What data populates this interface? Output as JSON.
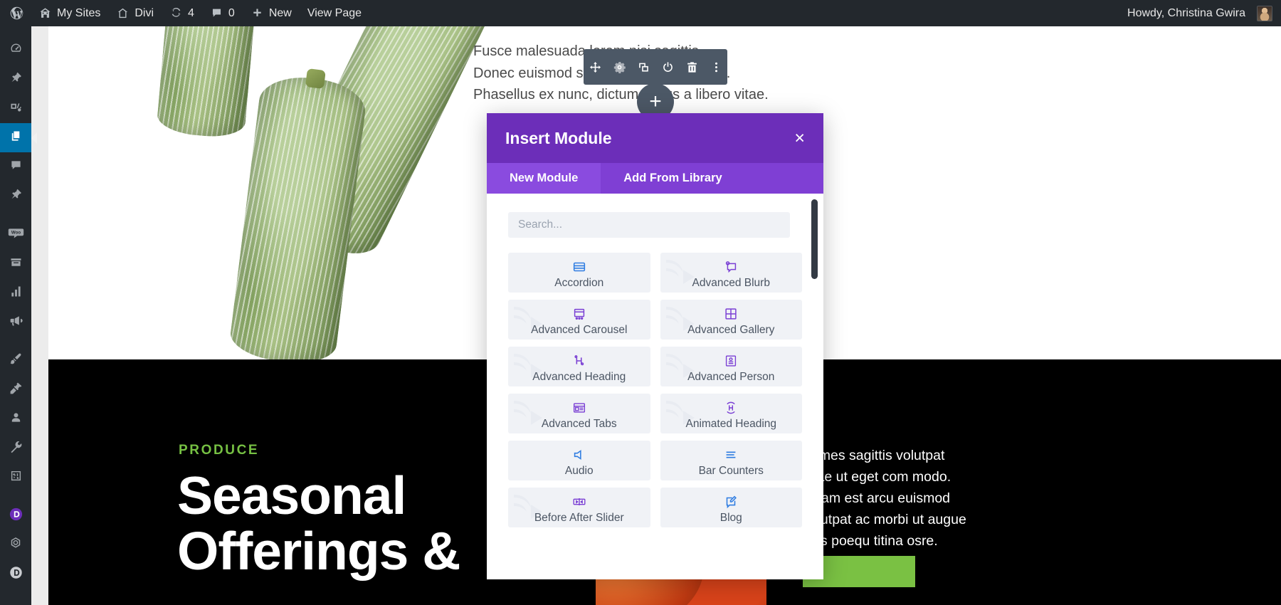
{
  "adminbar": {
    "left_items": [
      {
        "label": "",
        "icon": "wordpress-logo-icon"
      },
      {
        "label": "My Sites",
        "icon": "multisite-icon"
      },
      {
        "label": "Divi",
        "icon": "home-icon"
      },
      {
        "label": "4",
        "icon": "updates-icon"
      },
      {
        "label": "0",
        "icon": "comment-bubble-icon"
      },
      {
        "label": "New",
        "icon": "plus-icon"
      },
      {
        "label": "View Page",
        "icon": ""
      }
    ],
    "howdy": "Howdy, Christina Gwira"
  },
  "sidebar": {
    "items": [
      {
        "name": "dashboard",
        "icon": "dashboard-icon",
        "current": false
      },
      {
        "name": "posts",
        "icon": "pin-icon",
        "current": false
      },
      {
        "name": "media",
        "icon": "media-icon",
        "current": false
      },
      {
        "name": "pages",
        "icon": "pages-icon",
        "current": true
      },
      {
        "name": "comments",
        "icon": "comment-bubble-icon",
        "current": false
      },
      {
        "name": "projects",
        "icon": "pin-icon",
        "current": false
      },
      {
        "name": "woocommerce",
        "icon": "woo-icon",
        "current": false
      },
      {
        "name": "products",
        "icon": "products-box-icon",
        "current": false
      },
      {
        "name": "analytics",
        "icon": "bar-chart-icon",
        "current": false
      },
      {
        "name": "marketing",
        "icon": "megaphone-icon",
        "current": false
      },
      {
        "name": "appearance",
        "icon": "paintbrush-icon",
        "current": false
      },
      {
        "name": "plugins",
        "icon": "plug-icon",
        "current": false
      },
      {
        "name": "users",
        "icon": "user-icon",
        "current": false
      },
      {
        "name": "tools",
        "icon": "wrench-icon",
        "current": false
      },
      {
        "name": "settings",
        "icon": "sliders-icon",
        "current": false
      },
      {
        "name": "divi",
        "icon": "divi-logo-icon",
        "current": false
      },
      {
        "name": "divi-modules",
        "icon": "gear-outline-icon",
        "current": false
      },
      {
        "name": "divi-d",
        "icon": "letter-d-icon",
        "current": false
      }
    ]
  },
  "divi_toolbar": {
    "buttons": [
      {
        "name": "move",
        "icon": "move-arrows-icon"
      },
      {
        "name": "settings",
        "icon": "gear-icon"
      },
      {
        "name": "duplicate",
        "icon": "duplicate-icon"
      },
      {
        "name": "disable",
        "icon": "power-icon"
      },
      {
        "name": "delete",
        "icon": "trash-icon"
      },
      {
        "name": "more",
        "icon": "kebab-menu-icon"
      }
    ],
    "add_label": "+"
  },
  "page_content": {
    "lorem_lines": [
      "Fusce malesuada lorem nisi sagittis.",
      "Donec euismod sem pretium vestibulum.",
      "Phasellus ex nunc, dictum luctus a libero vitae."
    ],
    "eyebrow": "PRODUCE",
    "heading_line1": "Seasonal",
    "heading_line2": "Offerings &",
    "right_text": "Fames sagittis volutpat vitae ut eget com modo. Quam est arcu euismod volutpat ac morbi ut augue felis poequ titina osre.",
    "green_accent": "#7ac143"
  },
  "modal": {
    "title": "Insert Module",
    "close_label": "×",
    "tabs": [
      {
        "label": "New Module",
        "active": true
      },
      {
        "label": "Add From Library",
        "active": false
      }
    ],
    "search_placeholder": "Search...",
    "search_value": "",
    "header_color": "#6c2eb9",
    "tabbar_color": "#7f3fd4",
    "modules": [
      {
        "label": "Accordion",
        "icon": "accordion-icon",
        "watermark": false
      },
      {
        "label": "Advanced Blurb",
        "icon": "advanced-blurb-icon",
        "watermark": true
      },
      {
        "label": "Advanced Carousel",
        "icon": "advanced-carousel-icon",
        "watermark": true
      },
      {
        "label": "Advanced Gallery",
        "icon": "advanced-gallery-icon",
        "watermark": true
      },
      {
        "label": "Advanced Heading",
        "icon": "advanced-heading-icon",
        "watermark": true
      },
      {
        "label": "Advanced Person",
        "icon": "advanced-person-icon",
        "watermark": true
      },
      {
        "label": "Advanced Tabs",
        "icon": "advanced-tabs-icon",
        "watermark": true
      },
      {
        "label": "Animated Heading",
        "icon": "animated-heading-icon",
        "watermark": true
      },
      {
        "label": "Audio",
        "icon": "audio-icon",
        "watermark": false
      },
      {
        "label": "Bar Counters",
        "icon": "bar-counters-icon",
        "watermark": false
      },
      {
        "label": "Before After Slider",
        "icon": "before-after-slider-icon",
        "watermark": true
      },
      {
        "label": "Blog",
        "icon": "blog-icon",
        "watermark": false
      }
    ]
  }
}
